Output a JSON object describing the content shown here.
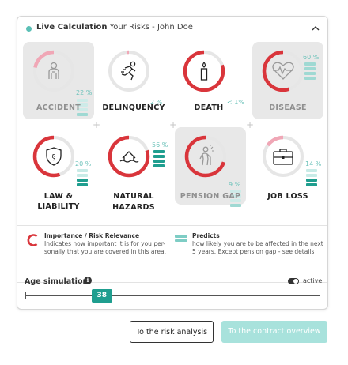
{
  "header": {
    "live_label": "Live Calculation",
    "subtitle": "Your Risks - John Doe",
    "expanded_icon": "chevron-up-icon"
  },
  "risks": [
    {
      "id": "accident",
      "label": "ACCIDENT",
      "label2": "",
      "percent": "22 %",
      "importance": 0.22,
      "bars": 1,
      "highlighted": true,
      "icon": "person-icon"
    },
    {
      "id": "delinquency",
      "label": "DELINQUENCY",
      "label2": "",
      "percent": "2 %",
      "importance": 0.02,
      "bars": 0,
      "highlighted": false,
      "icon": "running-person-icon"
    },
    {
      "id": "death",
      "label": "DEATH",
      "label2": "",
      "percent": "< 1%",
      "importance": 0.8,
      "bars": 0,
      "highlighted": false,
      "icon": "candle-icon"
    },
    {
      "id": "disease",
      "label": "DISEASE",
      "label2": "",
      "percent": "60 %",
      "importance": 0.55,
      "bars": 4,
      "highlighted": true,
      "icon": "heartbeat-icon"
    },
    {
      "id": "law",
      "label": "LAW & LIABILITY",
      "label2": "",
      "percent": "20 %",
      "importance": 0.55,
      "bars": 2,
      "highlighted": false,
      "icon": "shield-paragraph-icon"
    },
    {
      "id": "natural",
      "label": "NATURAL",
      "label2": "HAZARDS",
      "percent": "56 %",
      "importance": 0.8,
      "bars": 4,
      "highlighted": false,
      "icon": "house-flood-icon"
    },
    {
      "id": "pension",
      "label": "PENSION GAP",
      "label2": "",
      "percent": "9 %",
      "importance": 0.7,
      "bars": 1,
      "highlighted": true,
      "icon": "elderly-person-icon"
    },
    {
      "id": "job",
      "label": "JOB LOSS",
      "label2": "",
      "percent": "14 %",
      "importance": 0.15,
      "bars": 2,
      "highlighted": false,
      "icon": "briefcase-icon"
    }
  ],
  "legend": {
    "importance_title": "Importance / Risk Relevance",
    "importance_text": "Indicates how important it is for you per-sonally that you are covered in this area.",
    "predicts_title": "Predicts",
    "predicts_text": "how likely you are to be affected in the next 5 years. Except pension gap - see details"
  },
  "age": {
    "label": "Age simulation",
    "info_icon": "i",
    "toggle_label": "active",
    "value": "38",
    "position_fraction": 0.26
  },
  "buttons": {
    "risk_analysis": "To the risk analysis",
    "contract_overview": "To the contract overview"
  },
  "colors": {
    "accent": "#1f9e8f",
    "teal_light": "#7ecdc5",
    "gauge_red": "#d9353b",
    "gauge_pink": "#f0a7b6",
    "gauge_track": "#e6e6e6"
  }
}
